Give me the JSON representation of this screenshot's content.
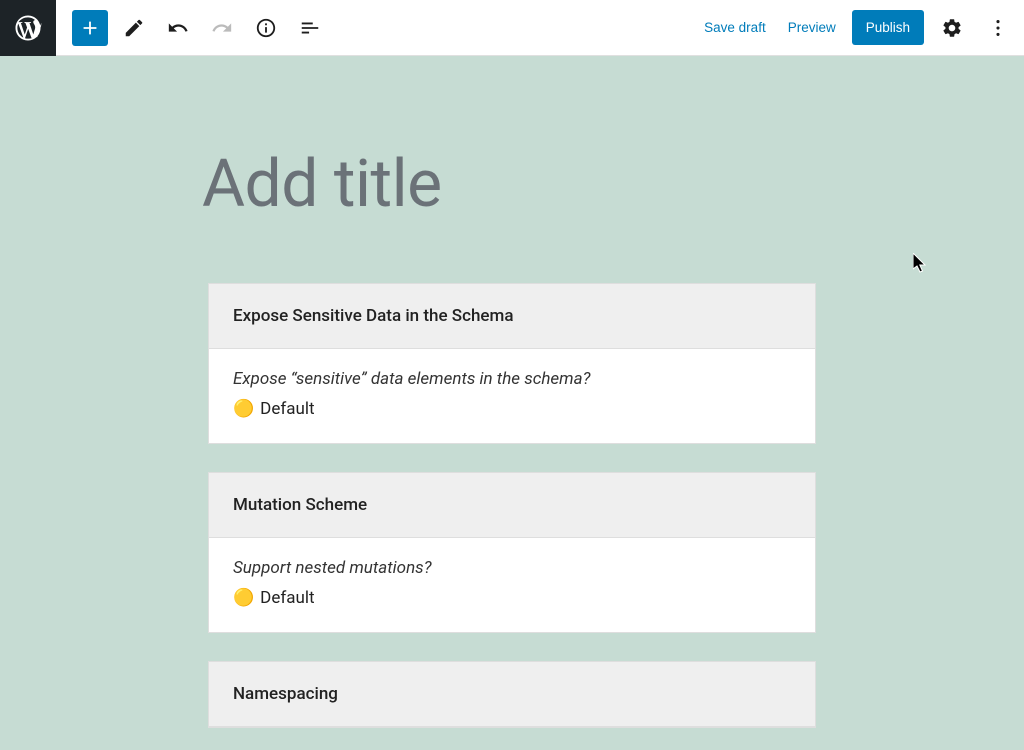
{
  "toolbar": {
    "save_draft": "Save draft",
    "preview": "Preview",
    "publish": "Publish"
  },
  "editor": {
    "title_placeholder": "Add title"
  },
  "blocks": [
    {
      "header": "Expose Sensitive Data in the Schema",
      "question": "Expose “sensitive” data elements in the schema?",
      "status_icon": "🟡",
      "value": "Default"
    },
    {
      "header": "Mutation Scheme",
      "question": "Support nested mutations?",
      "status_icon": "🟡",
      "value": "Default"
    },
    {
      "header": "Namespacing",
      "question": "",
      "status_icon": "",
      "value": ""
    }
  ]
}
